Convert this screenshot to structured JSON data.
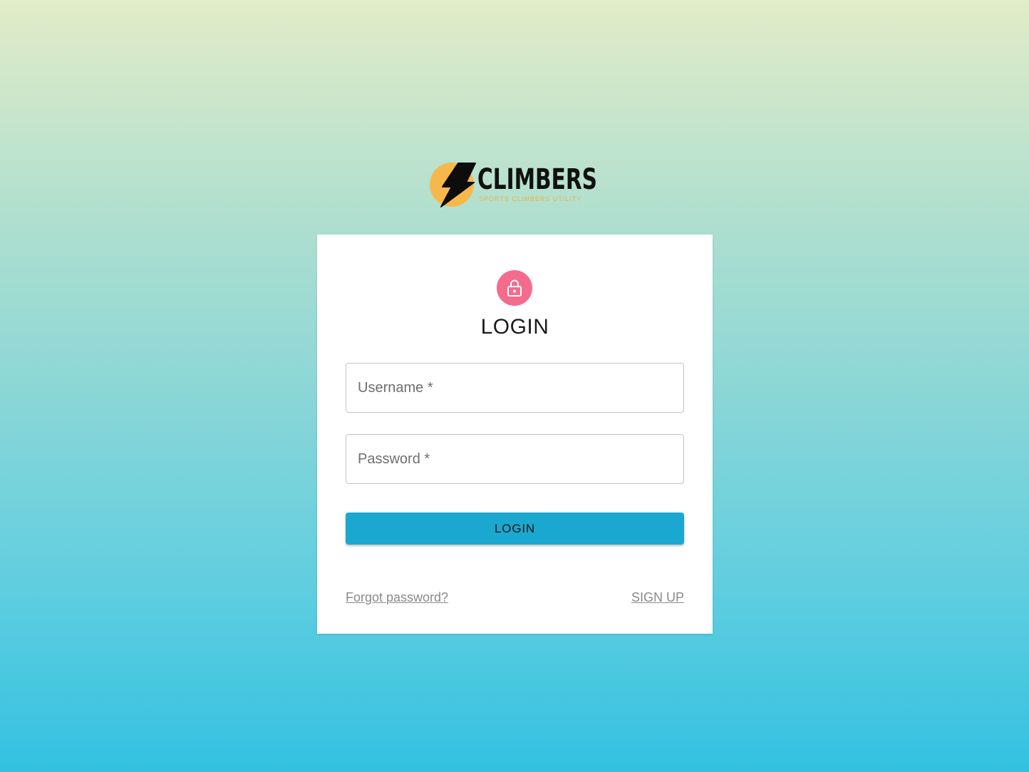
{
  "logo": {
    "name": "CLIMBERS",
    "tagline": "SPORTS CLIMBERS UTILITY",
    "icon": "lightning-bolt-icon",
    "circle_color": "#f7b84b"
  },
  "login_card": {
    "icon": "lock-icon",
    "icon_bg_color": "#f56b8d",
    "title": "LOGIN",
    "username": {
      "placeholder": "Username *",
      "value": ""
    },
    "password": {
      "placeholder": "Password *",
      "value": ""
    },
    "submit_label": "LOGIN",
    "submit_color": "#1ba8d0",
    "forgot_label": "Forgot password?",
    "signup_label": "SIGN UP"
  }
}
